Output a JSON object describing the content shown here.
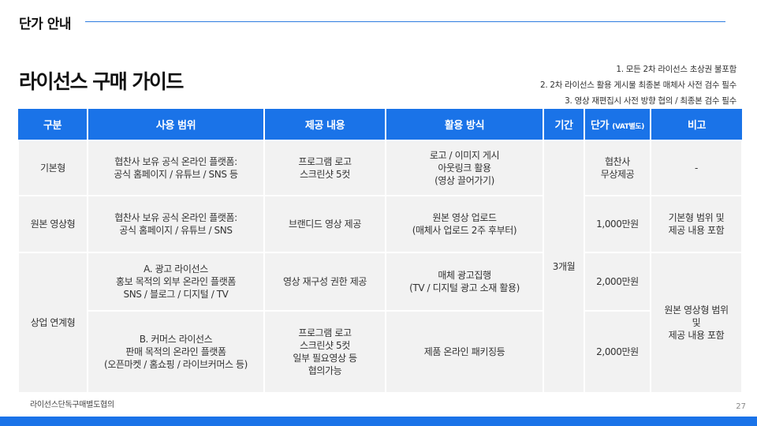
{
  "header": {
    "title": "단가 안내"
  },
  "guide_title": "라이선스 구매 가이드",
  "notes": [
    "1. 모든 2차 라이선스 초상권 불포함",
    "2. 2차 라이선스 활용 게시물 최종본 매체사 사전 검수 필수",
    "3. 영상 재편집시 사전 방향 협의 / 최종본 검수 필수"
  ],
  "table": {
    "headers": {
      "category": "구분",
      "scope": "사용 범위",
      "content": "제공 내용",
      "method": "활용 방식",
      "period": "기간",
      "price": "단가",
      "price_note": "(VAT별도)",
      "remark": "비고"
    },
    "rows": [
      {
        "category": "기본형",
        "scope": [
          "협찬사 보유 공식 온라인 플랫폼:",
          "공식 홈페이지 / 유튜브 / SNS 등"
        ],
        "content": [
          "프로그램 로고",
          "스크린샷 5컷"
        ],
        "method": [
          "로고 / 이미지 게시",
          "아웃링크 활용",
          "(영상 끌어가기)"
        ],
        "price": [
          "협찬사",
          "무상제공"
        ],
        "remark": [
          "-"
        ]
      },
      {
        "category": "원본 영상형",
        "scope": [
          "협찬사 보유 공식 온라인 플랫폼:",
          "공식 홈페이지 / 유튜브 / SNS"
        ],
        "content": [
          "브랜디드 영상 제공"
        ],
        "method": [
          "원본 영상 업로드",
          "(매체사 업로드 2주 후부터)"
        ],
        "price": [
          "1,000만원"
        ],
        "remark": [
          "기본형 범위 및",
          "제공 내용 포함"
        ]
      },
      {
        "category": "상업 연계형",
        "scope": [
          "A. 광고 라이선스",
          "홍보 목적의 외부 온라인 플랫폼",
          "SNS / 블로그 / 디지털 / TV"
        ],
        "content": [
          "영상 재구성 권한 제공"
        ],
        "method": [
          "매체 광고집행",
          "(TV / 디지털 광고 소재 활용)"
        ],
        "price": [
          "2,000만원"
        ],
        "remark": [
          "원본 영상형 범위",
          "및",
          "제공 내용 포함"
        ]
      },
      {
        "scope": [
          "B. 커머스 라이선스",
          "판매 목적의 온라인 플랫폼",
          "(오픈마켓 / 홈쇼핑 / 라이브커머스 등)"
        ],
        "content": [
          "프로그램 로고",
          "스크린샷 5컷",
          "일부 필요영상 등",
          "협의가능"
        ],
        "method": [
          "제품 온라인 패키징등"
        ],
        "price": [
          "2,000만원"
        ]
      }
    ],
    "period": "3개월"
  },
  "footnote": "라이선스단독구매별도협의",
  "page_number": "27",
  "colors": {
    "accent": "#1a73e8",
    "cell_bg": "#f2f2f2",
    "rule": "#2e7de0"
  }
}
